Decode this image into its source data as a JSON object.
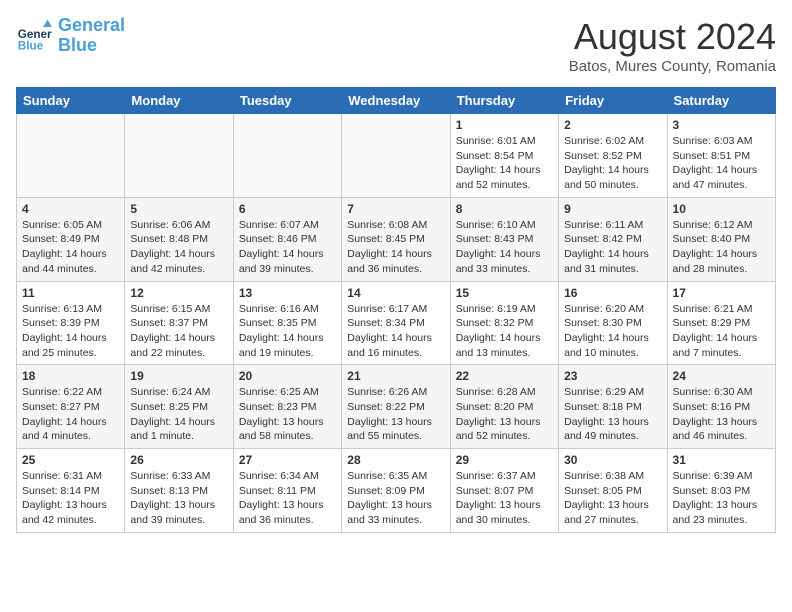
{
  "header": {
    "logo_line1": "General",
    "logo_line2": "Blue",
    "month": "August 2024",
    "location": "Batos, Mures County, Romania"
  },
  "days_of_week": [
    "Sunday",
    "Monday",
    "Tuesday",
    "Wednesday",
    "Thursday",
    "Friday",
    "Saturday"
  ],
  "weeks": [
    [
      {
        "day": "",
        "info": ""
      },
      {
        "day": "",
        "info": ""
      },
      {
        "day": "",
        "info": ""
      },
      {
        "day": "",
        "info": ""
      },
      {
        "day": "1",
        "sunrise": "6:01 AM",
        "sunset": "8:54 PM",
        "daylight": "14 hours and 52 minutes."
      },
      {
        "day": "2",
        "sunrise": "6:02 AM",
        "sunset": "8:52 PM",
        "daylight": "14 hours and 50 minutes."
      },
      {
        "day": "3",
        "sunrise": "6:03 AM",
        "sunset": "8:51 PM",
        "daylight": "14 hours and 47 minutes."
      }
    ],
    [
      {
        "day": "4",
        "sunrise": "6:05 AM",
        "sunset": "8:49 PM",
        "daylight": "14 hours and 44 minutes."
      },
      {
        "day": "5",
        "sunrise": "6:06 AM",
        "sunset": "8:48 PM",
        "daylight": "14 hours and 42 minutes."
      },
      {
        "day": "6",
        "sunrise": "6:07 AM",
        "sunset": "8:46 PM",
        "daylight": "14 hours and 39 minutes."
      },
      {
        "day": "7",
        "sunrise": "6:08 AM",
        "sunset": "8:45 PM",
        "daylight": "14 hours and 36 minutes."
      },
      {
        "day": "8",
        "sunrise": "6:10 AM",
        "sunset": "8:43 PM",
        "daylight": "14 hours and 33 minutes."
      },
      {
        "day": "9",
        "sunrise": "6:11 AM",
        "sunset": "8:42 PM",
        "daylight": "14 hours and 31 minutes."
      },
      {
        "day": "10",
        "sunrise": "6:12 AM",
        "sunset": "8:40 PM",
        "daylight": "14 hours and 28 minutes."
      }
    ],
    [
      {
        "day": "11",
        "sunrise": "6:13 AM",
        "sunset": "8:39 PM",
        "daylight": "14 hours and 25 minutes."
      },
      {
        "day": "12",
        "sunrise": "6:15 AM",
        "sunset": "8:37 PM",
        "daylight": "14 hours and 22 minutes."
      },
      {
        "day": "13",
        "sunrise": "6:16 AM",
        "sunset": "8:35 PM",
        "daylight": "14 hours and 19 minutes."
      },
      {
        "day": "14",
        "sunrise": "6:17 AM",
        "sunset": "8:34 PM",
        "daylight": "14 hours and 16 minutes."
      },
      {
        "day": "15",
        "sunrise": "6:19 AM",
        "sunset": "8:32 PM",
        "daylight": "14 hours and 13 minutes."
      },
      {
        "day": "16",
        "sunrise": "6:20 AM",
        "sunset": "8:30 PM",
        "daylight": "14 hours and 10 minutes."
      },
      {
        "day": "17",
        "sunrise": "6:21 AM",
        "sunset": "8:29 PM",
        "daylight": "14 hours and 7 minutes."
      }
    ],
    [
      {
        "day": "18",
        "sunrise": "6:22 AM",
        "sunset": "8:27 PM",
        "daylight": "14 hours and 4 minutes."
      },
      {
        "day": "19",
        "sunrise": "6:24 AM",
        "sunset": "8:25 PM",
        "daylight": "14 hours and 1 minute."
      },
      {
        "day": "20",
        "sunrise": "6:25 AM",
        "sunset": "8:23 PM",
        "daylight": "13 hours and 58 minutes."
      },
      {
        "day": "21",
        "sunrise": "6:26 AM",
        "sunset": "8:22 PM",
        "daylight": "13 hours and 55 minutes."
      },
      {
        "day": "22",
        "sunrise": "6:28 AM",
        "sunset": "8:20 PM",
        "daylight": "13 hours and 52 minutes."
      },
      {
        "day": "23",
        "sunrise": "6:29 AM",
        "sunset": "8:18 PM",
        "daylight": "13 hours and 49 minutes."
      },
      {
        "day": "24",
        "sunrise": "6:30 AM",
        "sunset": "8:16 PM",
        "daylight": "13 hours and 46 minutes."
      }
    ],
    [
      {
        "day": "25",
        "sunrise": "6:31 AM",
        "sunset": "8:14 PM",
        "daylight": "13 hours and 42 minutes."
      },
      {
        "day": "26",
        "sunrise": "6:33 AM",
        "sunset": "8:13 PM",
        "daylight": "13 hours and 39 minutes."
      },
      {
        "day": "27",
        "sunrise": "6:34 AM",
        "sunset": "8:11 PM",
        "daylight": "13 hours and 36 minutes."
      },
      {
        "day": "28",
        "sunrise": "6:35 AM",
        "sunset": "8:09 PM",
        "daylight": "13 hours and 33 minutes."
      },
      {
        "day": "29",
        "sunrise": "6:37 AM",
        "sunset": "8:07 PM",
        "daylight": "13 hours and 30 minutes."
      },
      {
        "day": "30",
        "sunrise": "6:38 AM",
        "sunset": "8:05 PM",
        "daylight": "13 hours and 27 minutes."
      },
      {
        "day": "31",
        "sunrise": "6:39 AM",
        "sunset": "8:03 PM",
        "daylight": "13 hours and 23 minutes."
      }
    ]
  ]
}
